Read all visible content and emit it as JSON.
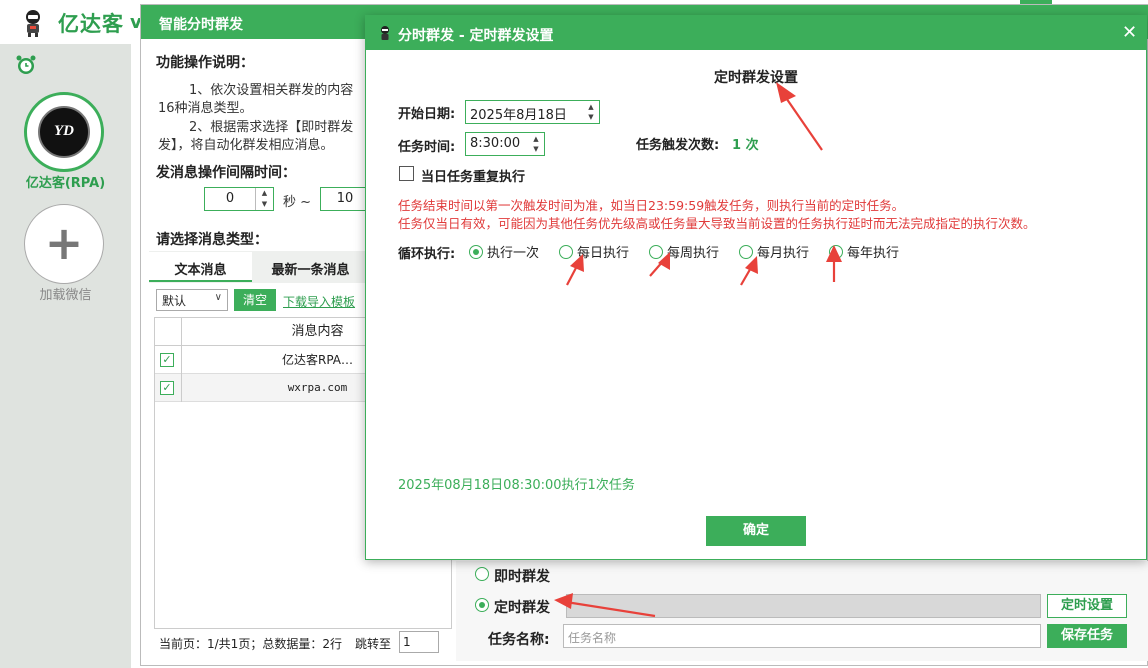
{
  "app": {
    "title": "亿达客",
    "title_suffix": "v",
    "account_name": "亿达客(RPA)",
    "account_logo_text": "YD",
    "add_wechat_label": "加载微信",
    "add_symbol": "+"
  },
  "back_dialog": {
    "title": "智能分时群发",
    "instructions_label": "功能操作说明：",
    "instruction_1a": "1、依次设置相关群发的内容",
    "instruction_1b": "16种消息类型。",
    "instruction_2a": "2、根据需求选择【即时群发",
    "instruction_2b": "发】，将自动化群发相应消息。",
    "interval_label": "发消息操作间隔时间：",
    "interval_from": "0",
    "interval_unit": "秒 ~",
    "interval_to": "10",
    "msg_type_label": "请选择消息类型：",
    "tabs": [
      "文本消息",
      "最新一条消息"
    ],
    "select_value": "默认",
    "clear_button": "清空",
    "download_link": "下载导入模板",
    "table_header": "消息内容",
    "rows": [
      {
        "checked": "✓",
        "content": "亿达客RPA…"
      },
      {
        "checked": "✓",
        "content": "wxrpa.com"
      }
    ],
    "pager_text": "当前页：1/共1页；总数据量：2行",
    "jump_label": "跳转至",
    "jump_value": "1",
    "instant_send_label": "即时群发",
    "timed_send_label": "定时群发",
    "timed_settings_button": "定时设置",
    "task_name_label": "任务名称:",
    "task_name_placeholder": "任务名称",
    "save_task_button": "保存任务"
  },
  "front_dialog": {
    "title": "分时群发 - 定时群发设置",
    "close_symbol": "✕",
    "heading": "定时群发设置",
    "start_date_label": "开始日期:",
    "start_date_value": "2025年8月18日",
    "task_time_label": "任务时间:",
    "task_time_value": "8:30:00",
    "trigger_count_label": "任务触发次数:",
    "trigger_count_value": "1 次",
    "repeat_label": "当日任务重复执行",
    "note_1": "任务结束时间以第一次触发时间为准，如当日23:59:59触发任务，则执行当前的定时任务。",
    "note_2": "任务仅当日有效，可能因为其他任务优先级高或任务量大导致当前设置的任务执行延时而无法完成指定的执行次数。",
    "loop_label": "循环执行:",
    "loop_options": [
      "执行一次",
      "每日执行",
      "每周执行",
      "每月执行",
      "每年执行"
    ],
    "status_text": "2025年08月18日08:30:00执行1次任务",
    "ok_button": "确定"
  },
  "colors": {
    "brand_green": "#3cae5a",
    "note_red": "#e03a3a",
    "arrow_red": "#e8413a"
  }
}
